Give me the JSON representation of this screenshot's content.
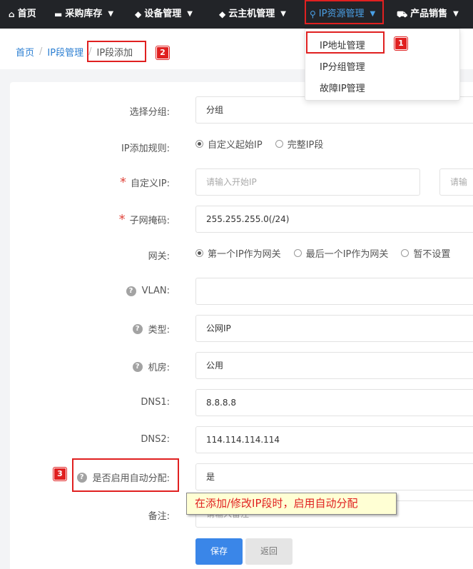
{
  "nav": {
    "items": [
      {
        "icon": "home-icon",
        "glyph": "⌂",
        "label": "首页"
      },
      {
        "icon": "inbox-icon",
        "glyph": "▬",
        "label": "采购库存"
      },
      {
        "icon": "cube-icon",
        "glyph": "◆",
        "label": "设备管理"
      },
      {
        "icon": "cube-icon",
        "glyph": "◆",
        "label": "云主机管理"
      },
      {
        "icon": "map-marker-icon",
        "glyph": "⚲",
        "label": "IP资源管理"
      },
      {
        "icon": "cart-icon",
        "glyph": "⛟",
        "label": "产品销售"
      }
    ],
    "active_color": "#4aa0e6"
  },
  "dropdown": {
    "items": [
      "IP地址管理",
      "IP分组管理",
      "故障IP管理"
    ]
  },
  "breadcrumb": {
    "home": "首页",
    "section": "IP段管理",
    "current": "IP段添加"
  },
  "form": {
    "group": {
      "label": "选择分组:",
      "value": "分组"
    },
    "rule": {
      "label": "IP添加规则:",
      "options": [
        "自定义起始IP",
        "完整IP段"
      ],
      "selected": 0
    },
    "custom_ip": {
      "label": "自定义IP:",
      "start_placeholder": "请输入开始IP",
      "end_placeholder": "请输"
    },
    "mask": {
      "label": "子网掩码:",
      "value": "255.255.255.0(/24)"
    },
    "gateway": {
      "label": "网关:",
      "options": [
        "第一个IP作为网关",
        "最后一个IP作为网关",
        "暂不设置"
      ],
      "selected": 0
    },
    "vlan": {
      "label": "VLAN:",
      "value": ""
    },
    "type": {
      "label": "类型:",
      "value": "公网IP"
    },
    "room": {
      "label": "机房:",
      "value": "公用"
    },
    "dns1": {
      "label": "DNS1:",
      "value": "8.8.8.8"
    },
    "dns2": {
      "label": "DNS2:",
      "value": "114.114.114.114"
    },
    "auto_assign": {
      "label": "是否启用自动分配:",
      "value": "是"
    },
    "remark": {
      "label": "备注:",
      "placeholder": "请输入备注"
    }
  },
  "buttons": {
    "save": "保存",
    "back": "返回"
  },
  "tooltip": "在添加/修改IP段时，启用自动分配",
  "annotations": {
    "badge1": "1",
    "badge2": "2",
    "badge3": "3"
  },
  "colors": {
    "nav_bg": "#222428",
    "primary": "#3a86e8",
    "highlight": "#e02020",
    "required": "#e0463d"
  }
}
